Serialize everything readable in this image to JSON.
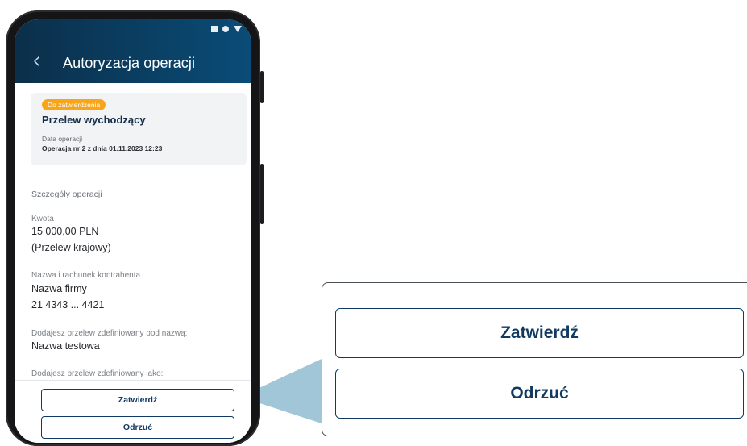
{
  "header": {
    "title": "Autoryzacja operacji"
  },
  "operation_card": {
    "badge": "Do zatwierdzenia",
    "title": "Przelew wychodzący",
    "date_label": "Data operacji",
    "date_value": "Operacja nr 2 z dnia 01.11.2023 12:23"
  },
  "details": {
    "section_title": "Szczegóły operacji",
    "amount_label": "Kwota",
    "amount_value": "15 000,00 PLN",
    "amount_type": "(Przelew krajowy)",
    "counterparty_label": "Nazwa i rachunek kontrahenta",
    "counterparty_name": "Nazwa firmy",
    "counterparty_account": "21 4343 ... 4421",
    "defined_name_label": "Dodajesz przelew zdefiniowany pod nazwą:",
    "defined_name_value": "Nazwa testowa",
    "defined_as_label": "Dodajesz przelew zdefiniowany jako:"
  },
  "actions": {
    "confirm_label": "Zatwierdź",
    "reject_label": "Odrzuć"
  },
  "callout": {
    "confirm_label": "Zatwierdź",
    "reject_label": "Odrzuć"
  },
  "colors": {
    "appbar_start": "#0b2f4a",
    "appbar_end": "#0a4c77",
    "badge": "#f9a51a",
    "primary_text": "#103a63",
    "callout_pointer": "#8fbcd0"
  },
  "icons": {
    "back": "chevron-left-icon",
    "status": [
      "square-icon",
      "dot-icon",
      "triangle-icon"
    ]
  }
}
